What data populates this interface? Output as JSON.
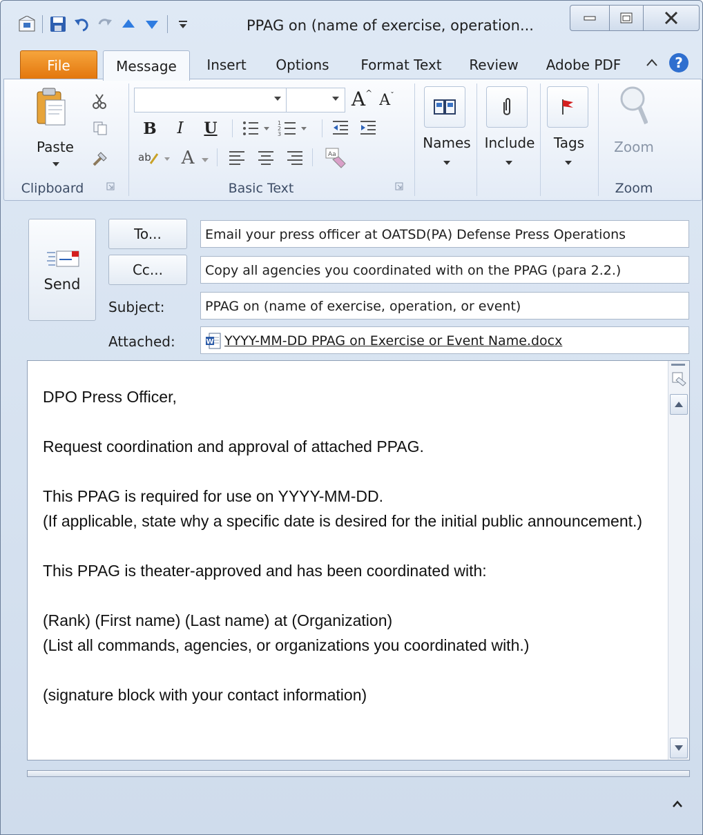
{
  "window": {
    "title": "PPAG on (name of exercise, operation..."
  },
  "tabs": [
    {
      "label": "File"
    },
    {
      "label": "Message"
    },
    {
      "label": "Insert"
    },
    {
      "label": "Options"
    },
    {
      "label": "Format Text"
    },
    {
      "label": "Review"
    },
    {
      "label": "Adobe PDF"
    }
  ],
  "ribbon": {
    "clipboard": {
      "paste_label": "Paste",
      "group_label": "Clipboard"
    },
    "basic_text": {
      "group_label": "Basic Text",
      "bold": "B",
      "italic": "I",
      "underline": "U",
      "grow": "A",
      "shrink": "A",
      "font_color": "A"
    },
    "names": {
      "label": "Names"
    },
    "include": {
      "label": "Include"
    },
    "tags": {
      "label": "Tags"
    },
    "zoom": {
      "label": "Zoom",
      "group_label": "Zoom"
    }
  },
  "header": {
    "send_label": "Send",
    "to_button": "To...",
    "cc_button": "Cc...",
    "subject_label": "Subject:",
    "attached_label": "Attached:",
    "to_value": "Email your press officer at OATSD(PA) Defense Press Operations",
    "cc_value": "Copy all agencies you coordinated with on the PPAG (para 2.2.)",
    "subject_value": "PPAG on (name of exercise, operation, or event)",
    "attachment": "YYYY-MM-DD PPAG on Exercise or Event Name.docx"
  },
  "body": {
    "greeting": "DPO Press Officer,",
    "line1": "Request coordination and approval of attached PPAG.",
    "line2a": "This PPAG is required for use on YYYY-MM-DD.",
    "line2b": "(If applicable, state why a specific date is desired for the initial public announcement.)",
    "line3": "This PPAG is theater-approved and has been coordinated with:",
    "line4a": "(Rank) (First name) (Last name) at (Organization)",
    "line4b": "(List all commands, agencies, or organizations you coordinated with.)",
    "line5": "(signature block with your contact information)"
  },
  "colors": {
    "file_tab": "#e2740b",
    "help": "#2f6fcf",
    "accent_blue": "#2d63b8"
  }
}
